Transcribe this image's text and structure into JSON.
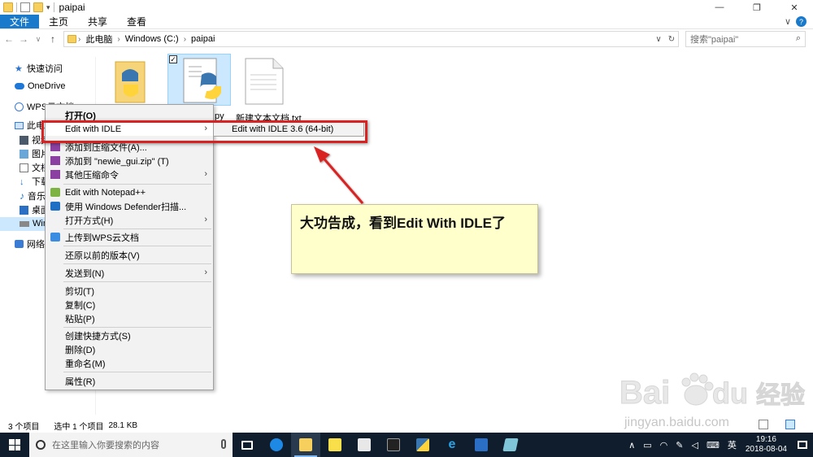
{
  "window": {
    "title": "paipai",
    "controls": [
      "—",
      "❐",
      "✕"
    ]
  },
  "ribbon": {
    "tabs": [
      "文件",
      "主页",
      "共享",
      "查看"
    ]
  },
  "address": {
    "crumbs": [
      "此电脑",
      "Windows (C:)",
      "paipai"
    ],
    "search_placeholder": "搜索\"paipai\""
  },
  "navpane": {
    "items": [
      "快速访问",
      "OneDrive",
      "WPS云文档",
      "此电脑",
      "视频",
      "图片",
      "文档",
      "下载",
      "音乐",
      "桌面",
      "Wind",
      "网络"
    ]
  },
  "files": [
    {
      "name": "",
      "icon": "python-folder-icon"
    },
    {
      "name": "py",
      "icon": "python-file-icon",
      "selected": true
    },
    {
      "name": "新建文本文档.txt",
      "icon": "text-file-icon"
    }
  ],
  "context_menu": {
    "items": [
      {
        "label": "打开(O)",
        "bold": true
      },
      {
        "label": "Edit with IDLE",
        "submenu": true,
        "highlight": true
      },
      {
        "label": "添加到压缩文件(A)...",
        "icon": "winrar-icon"
      },
      {
        "label": "添加到 \"newie_gui.zip\" (T)",
        "icon": "winrar-icon"
      },
      {
        "label": "其他压缩命令",
        "icon": "winrar-icon",
        "submenu": true
      },
      {
        "label": "Edit with Notepad++",
        "icon": "notepadpp-icon"
      },
      {
        "label": "使用 Windows Defender扫描...",
        "icon": "defender-icon"
      },
      {
        "label": "打开方式(H)",
        "submenu": true
      },
      {
        "label": "上传到WPS云文档",
        "icon": "wps-icon"
      },
      {
        "label": "还原以前的版本(V)"
      },
      {
        "label": "发送到(N)",
        "submenu": true
      },
      {
        "label": "剪切(T)"
      },
      {
        "label": "复制(C)"
      },
      {
        "label": "粘贴(P)"
      },
      {
        "label": "创建快捷方式(S)"
      },
      {
        "label": "删除(D)"
      },
      {
        "label": "重命名(M)"
      },
      {
        "label": "属性(R)"
      }
    ],
    "submenu_item": "Edit with IDLE 3.6 (64-bit)"
  },
  "callout": {
    "text": "大功告成，看到Edit With IDLE了"
  },
  "statusbar": {
    "item_count": "3 个项目",
    "selected": "选中 1 个项目",
    "size": "28.1 KB"
  },
  "taskbar": {
    "search_placeholder": "在这里输入你要搜索的内容",
    "ime": "英",
    "time": "19:16",
    "date": "2018-08-04"
  },
  "watermark": {
    "brand": "Bai",
    "brand_cn": "经验",
    "url": "jingyan.baidu.com"
  },
  "colors": {
    "accent": "#1979ca",
    "highlight_red": "#d92323",
    "callout_bg": "#ffffcc",
    "taskbar": "#101d2c"
  }
}
